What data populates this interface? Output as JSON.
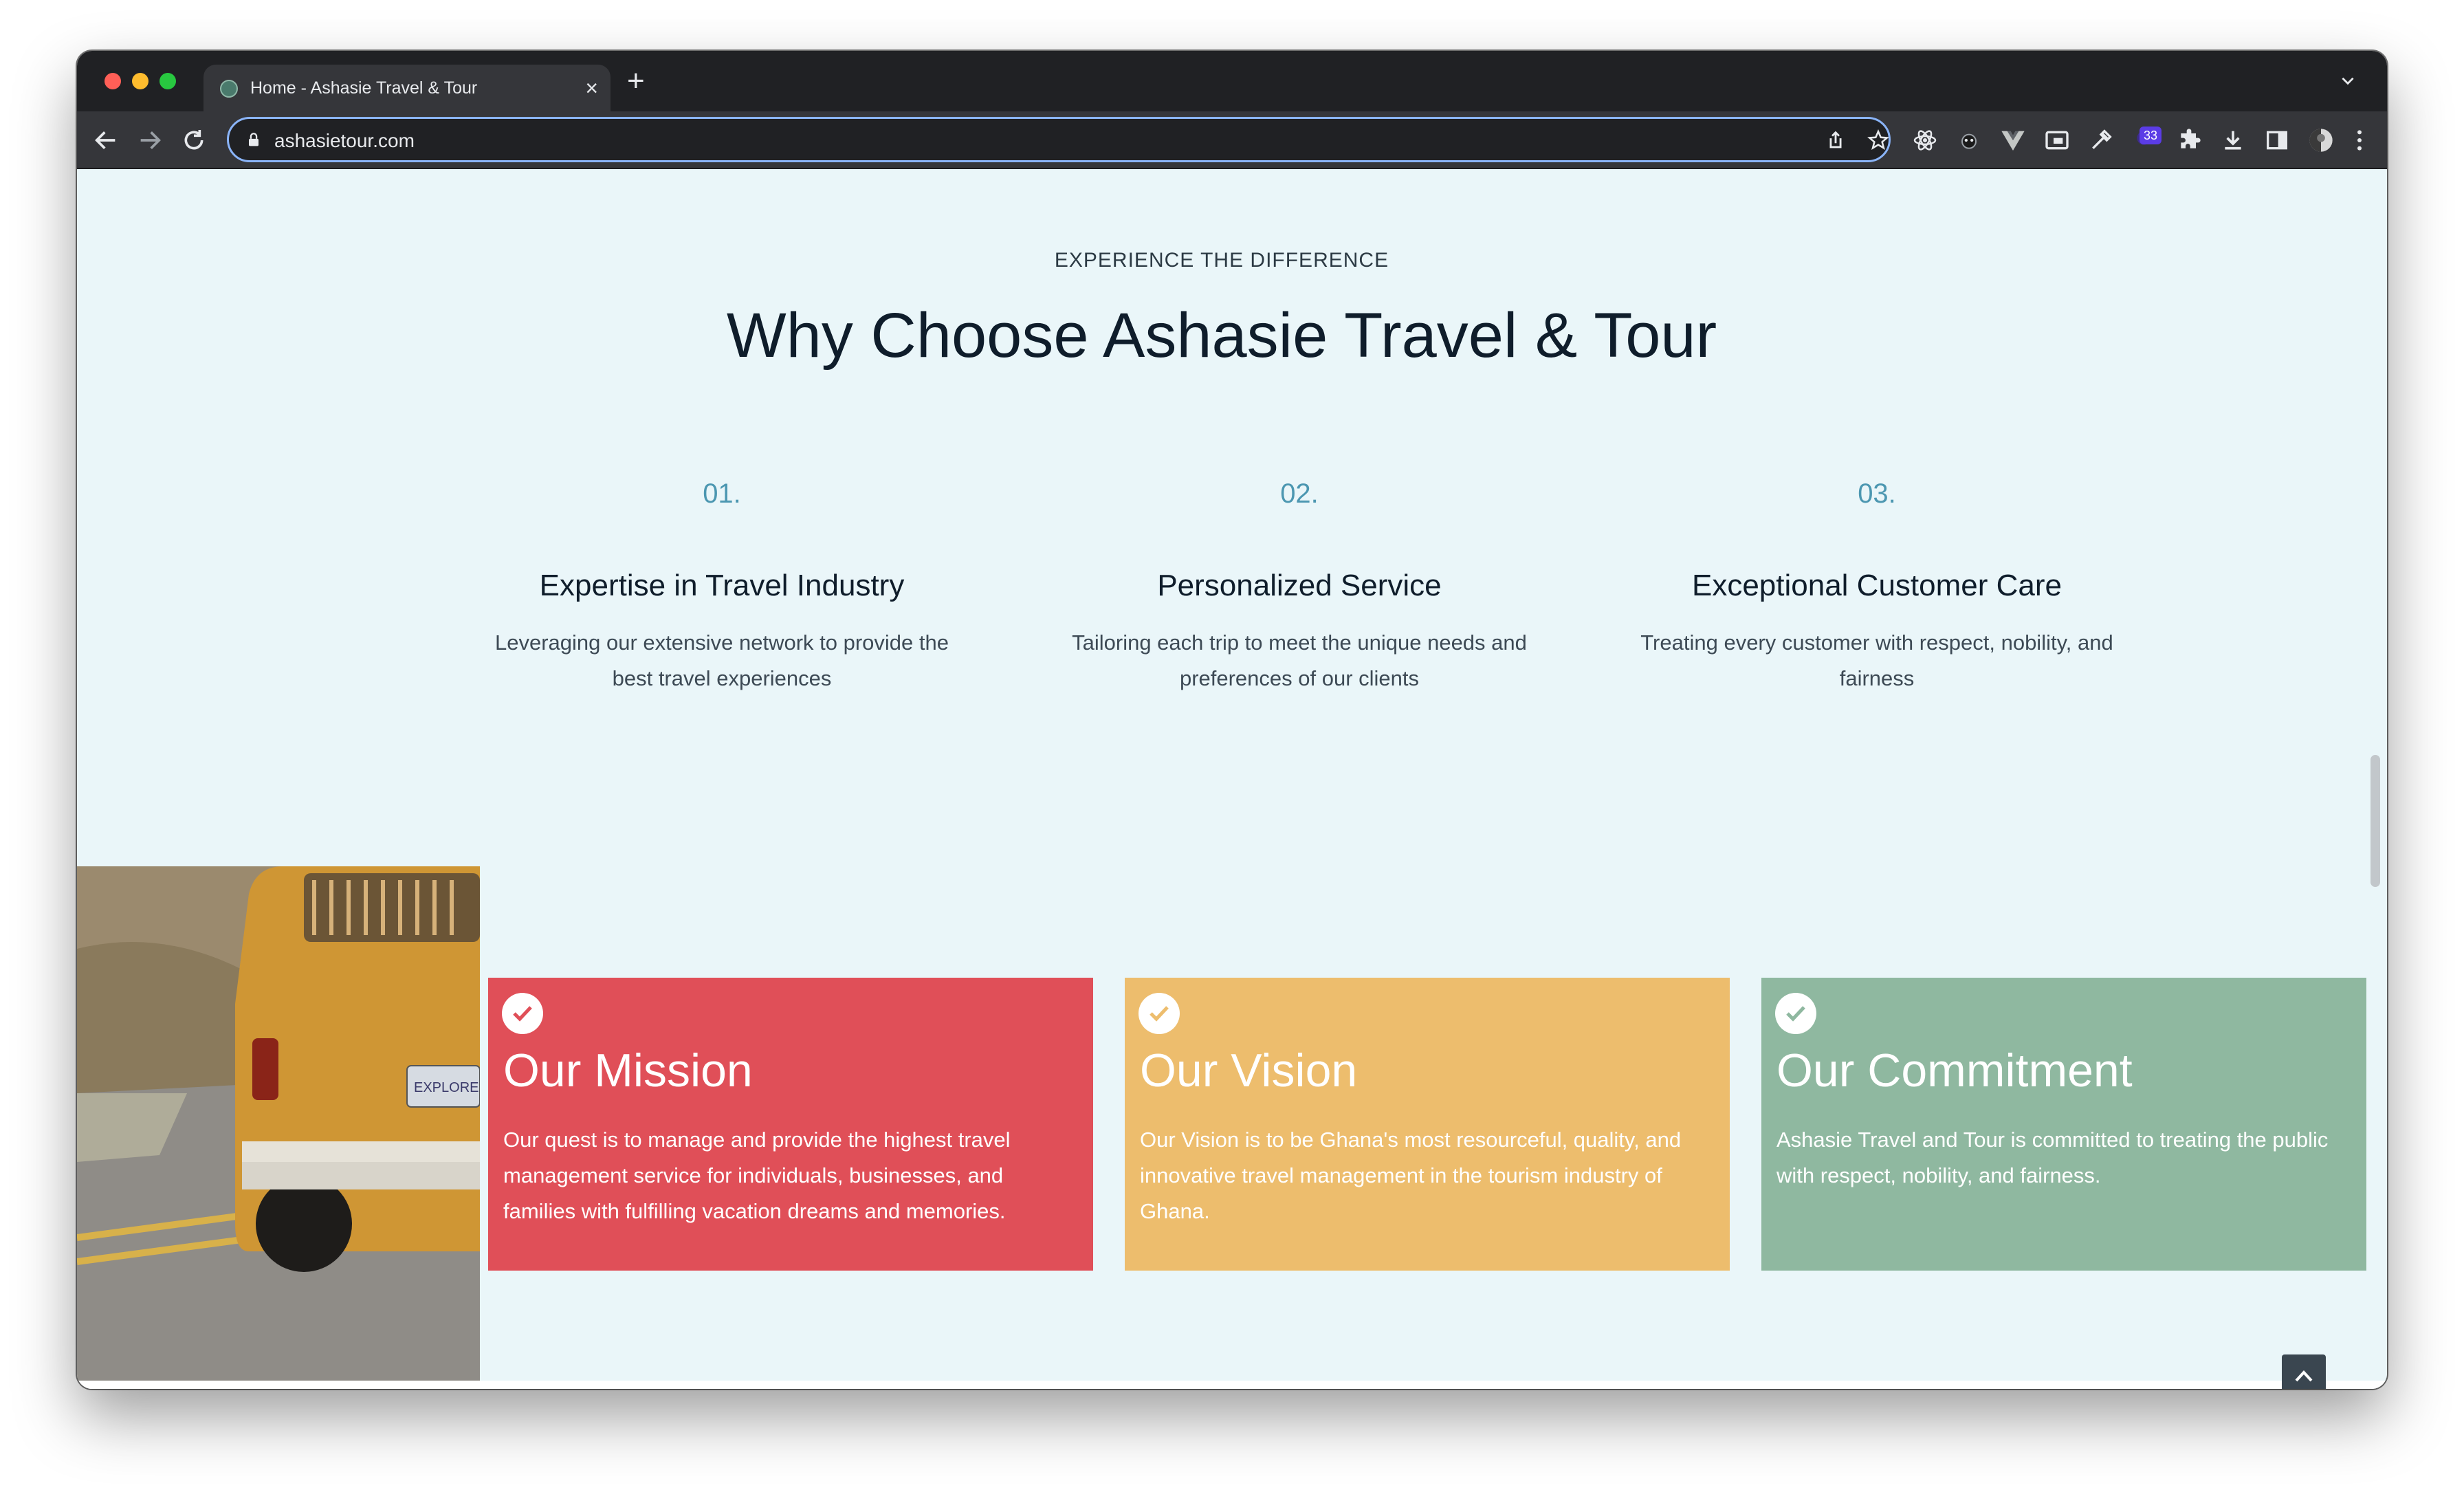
{
  "browser": {
    "tab_title": "Home - Ashasie Travel & Tour",
    "tab_close": "×",
    "new_tab": "+",
    "url": "ashasietour.com",
    "extension_badge": "33"
  },
  "section": {
    "eyebrow": "EXPERIENCE THE DIFFERENCE",
    "headline": "Why Choose Ashasie Travel & Tour"
  },
  "features": [
    {
      "number": "01.",
      "title": "Expertise in Travel Industry",
      "description": "Leveraging our extensive network to provide the best travel experiences"
    },
    {
      "number": "02.",
      "title": "Personalized Service",
      "description": "Tailoring each trip to meet the unique needs and preferences of our clients"
    },
    {
      "number": "03.",
      "title": "Exceptional Customer Care",
      "description": "Treating every customer with respect, nobility, and fairness"
    }
  ],
  "cards": [
    {
      "title": "Our Mission",
      "text": "Our quest is to manage and provide the highest travel management service for individuals, businesses, and families with fulfilling vacation dreams and memories.",
      "color": "#e04f58"
    },
    {
      "title": "Our Vision",
      "text": "Our Vision is to be Ghana's most resourceful, quality, and innovative travel management in the tourism industry of Ghana.",
      "color": "#edbd6d"
    },
    {
      "title": "Our Commitment",
      "text": "Ashasie Travel and Tour is committed to treating the public with respect, nobility, and fairness.",
      "color": "#8fb8a0"
    }
  ],
  "image": {
    "plate_text": "EXPLORE"
  },
  "colors": {
    "accent_number": "#4c97b1",
    "page_background": "#eaf6f9",
    "heading": "#0f1d2b"
  },
  "icons": {
    "back": "arrow-left-icon",
    "forward": "arrow-right-icon",
    "reload": "reload-icon",
    "lock": "lock-icon",
    "share": "share-icon",
    "bookmark": "star-icon",
    "to_top": "chevron-up-icon",
    "check": "check-icon"
  }
}
